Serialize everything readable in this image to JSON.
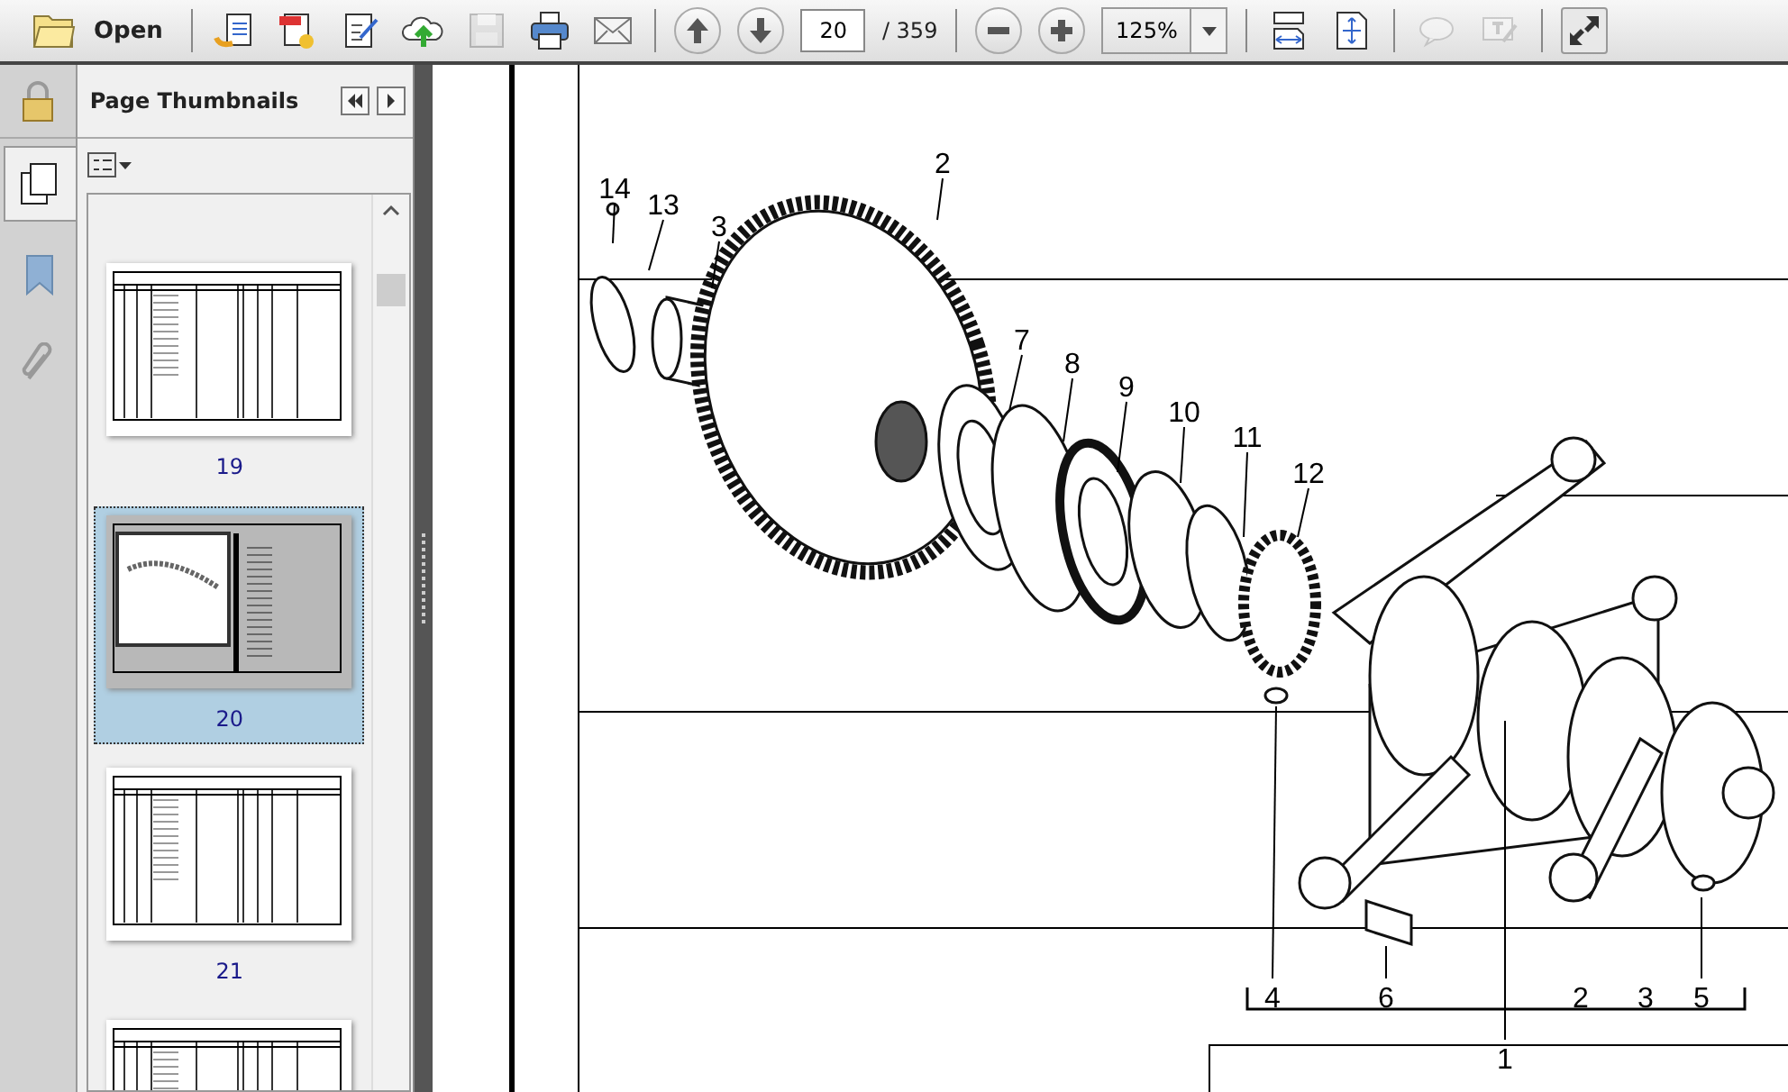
{
  "toolbar": {
    "groups": [
      [
        {
          "kind": "open",
          "label": "Open"
        }
      ],
      [
        {
          "kind": "create",
          "disabled": false
        },
        {
          "kind": "export",
          "disabled": false
        },
        {
          "kind": "edit",
          "disabled": false
        },
        {
          "kind": "upload",
          "disabled": false
        },
        {
          "kind": "save",
          "disabled": true
        },
        {
          "kind": "print",
          "disabled": false
        },
        {
          "kind": "mail",
          "disabled": false
        }
      ],
      [
        {
          "kind": "prev",
          "disabled": false
        },
        {
          "kind": "next",
          "disabled": false
        },
        {
          "kind": "page_field",
          "value": "20"
        },
        {
          "kind": "page_count",
          "text": "/ 359"
        }
      ],
      [
        {
          "kind": "zoom_out",
          "disabled": false
        },
        {
          "kind": "zoom_in",
          "disabled": false
        },
        {
          "kind": "zoom_field",
          "value": "125%"
        }
      ],
      [
        {
          "kind": "fit_width",
          "disabled": false
        },
        {
          "kind": "fit_page",
          "disabled": false
        }
      ],
      [
        {
          "kind": "comment",
          "disabled": true
        },
        {
          "kind": "sign",
          "disabled": true
        }
      ],
      [
        {
          "kind": "fullscreen",
          "disabled": false
        }
      ]
    ]
  },
  "sidebar": {
    "rail_tabs": [
      {
        "kind": "pages",
        "selected": true
      },
      {
        "kind": "bookmarks",
        "selected": false
      },
      {
        "kind": "attachments",
        "selected": false
      }
    ],
    "panel": {
      "title": "Page Thumbnails",
      "thumbnails": [
        {
          "label": "19",
          "kind": "table",
          "selected": false
        },
        {
          "label": "20",
          "kind": "figure",
          "selected": true
        },
        {
          "label": "21",
          "kind": "table",
          "selected": false
        },
        {
          "kind": "table",
          "selected": false
        }
      ]
    }
  },
  "document": {
    "callouts": [
      {
        "text": "14"
      },
      {
        "text": "13"
      },
      {
        "text": "3"
      },
      {
        "text": "2"
      },
      {
        "text": "7"
      },
      {
        "text": "8"
      },
      {
        "text": "9"
      },
      {
        "text": "10"
      },
      {
        "text": "11"
      },
      {
        "text": "12"
      },
      {
        "text": "4"
      },
      {
        "text": "6"
      },
      {
        "text": "1"
      },
      {
        "text": "2"
      },
      {
        "text": "3"
      },
      {
        "text": "5"
      }
    ]
  }
}
